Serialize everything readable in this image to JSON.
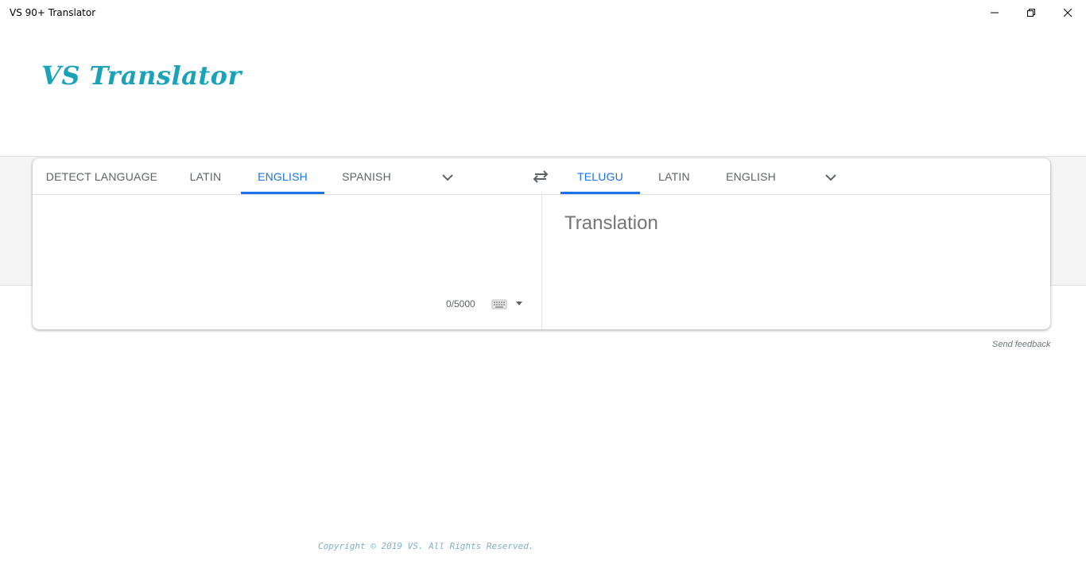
{
  "window": {
    "title": "VS 90+ Translator",
    "controls": [
      "minimize-icon",
      "restore-icon",
      "close-icon"
    ]
  },
  "logo": {
    "text": "VS Translator",
    "color": "#1aa3b8"
  },
  "source_tabs": [
    {
      "label": "DETECT LANGUAGE",
      "active": false
    },
    {
      "label": "LATIN",
      "active": false
    },
    {
      "label": "ENGLISH",
      "active": true
    },
    {
      "label": "SPANISH",
      "active": false
    }
  ],
  "target_tabs": [
    {
      "label": "TELUGU",
      "active": true
    },
    {
      "label": "LATIN",
      "active": false
    },
    {
      "label": "ENGLISH",
      "active": false
    }
  ],
  "icons": {
    "more_languages": "chevron-down-icon",
    "swap": "swap-arrows-icon",
    "keyboard": "keyboard-icon"
  },
  "source": {
    "value": "",
    "char_count": "0/5000"
  },
  "target": {
    "placeholder": "Translation"
  },
  "footer": {
    "feedback": "Send feedback",
    "copyright": "Copyright © 2019 VS. All Rights Reserved."
  },
  "colors": {
    "accent": "#1a73e8",
    "logo": "#1aa3b8",
    "copyright": "#7fb0c4"
  }
}
